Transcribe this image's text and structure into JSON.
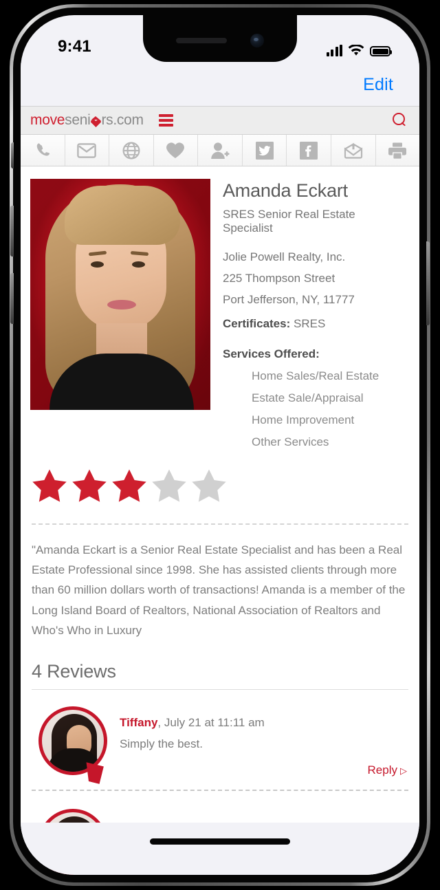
{
  "status_bar": {
    "time": "9:41",
    "signal_icon": "cellular-bars-icon",
    "wifi_icon": "wifi-icon",
    "battery_icon": "battery-full-icon"
  },
  "navbar": {
    "edit_label": "Edit"
  },
  "site_header": {
    "logo": {
      "part1": "move",
      "part2": "seni",
      "heart": "heart-house-icon",
      "part3": "rs.com"
    },
    "menu_icon": "hamburger-menu-icon",
    "search_icon": "search-icon"
  },
  "toolbar": {
    "items": [
      {
        "name": "phone-icon",
        "label": "Call"
      },
      {
        "name": "envelope-icon",
        "label": "Email"
      },
      {
        "name": "globe-icon",
        "label": "Website"
      },
      {
        "name": "heart-icon",
        "label": "Favorite"
      },
      {
        "name": "add-person-icon",
        "label": "Add Contact"
      },
      {
        "name": "twitter-icon",
        "label": "Twitter"
      },
      {
        "name": "facebook-icon",
        "label": "Facebook"
      },
      {
        "name": "share-mail-icon",
        "label": "Share"
      },
      {
        "name": "printer-icon",
        "label": "Print"
      }
    ]
  },
  "profile": {
    "photo_alt": "Amanda Eckart headshot",
    "name": "Amanda Eckart",
    "title": "SRES Senior Real Estate Specialist",
    "company": "Jolie Powell Realty, Inc.",
    "street": "225 Thompson Street",
    "city_state_zip": "Port Jefferson, NY, 11777",
    "certificates_label": "Certificates:",
    "certificates_value": "SRES",
    "services_label": "Services Offered:",
    "services": [
      "Home Sales/Real Estate",
      "Estate Sale/Appraisal",
      "Home Improvement",
      "Other Services"
    ],
    "rating": {
      "value": 3,
      "max": 5,
      "filled_color": "#ce1f2e",
      "empty_color": "#d0d0d0"
    }
  },
  "bio": {
    "text": "\"Amanda Eckart is a Senior Real Estate Specialist and has been a Real Estate Professional since 1998. She has assisted clients through more than 60 million dollars worth of transactions! Amanda is a member of the Long Island Board of Realtors, National Association of Realtors and Who's Who in Luxury"
  },
  "reviews": {
    "heading": "4 Reviews",
    "count": 4,
    "items": [
      {
        "author": "Tiffany",
        "meta": ", July 21 at 11:11 am",
        "text": "Simply the best.",
        "reply_label": "Reply",
        "reply_caret": "▷"
      }
    ]
  },
  "colors": {
    "brand_red": "#c5162a",
    "logo_red": "#cf2030",
    "ios_blue": "#007aff",
    "text_gray": "#7b7b7b"
  }
}
